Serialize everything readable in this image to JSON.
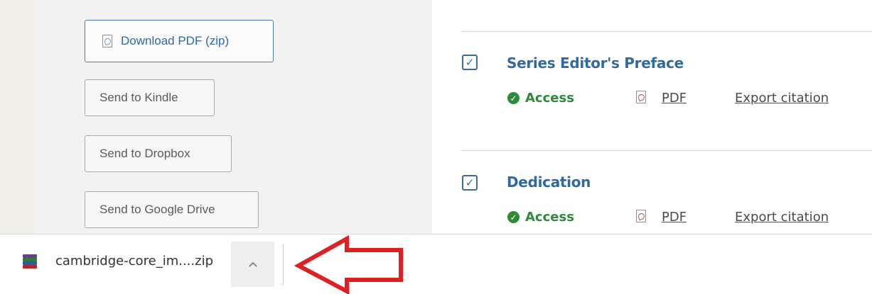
{
  "sidebar": {
    "download_pdf_label": "Download PDF (zip)",
    "send_to_kindle_label": "Send to Kindle",
    "send_to_dropbox_label": "Send to Dropbox",
    "send_to_google_drive_label": "Send to Google Drive"
  },
  "items": [
    {
      "title": "Series Editor's Preface",
      "checked": true,
      "access_label": "Access",
      "pdf_label": "PDF",
      "export_label": "Export citation"
    },
    {
      "title": "Dedication",
      "checked": true,
      "access_label": "Access",
      "pdf_label": "PDF",
      "export_label": "Export citation"
    }
  ],
  "download_bar": {
    "file_name": "cambridge-core_im....zip",
    "file_icon": "winrar-archive-icon",
    "expand_icon": "chevron-up-icon"
  },
  "colors": {
    "link_blue": "#2f6aa3",
    "access_green": "#2e8a3a",
    "annotation_red": "#e02020"
  }
}
